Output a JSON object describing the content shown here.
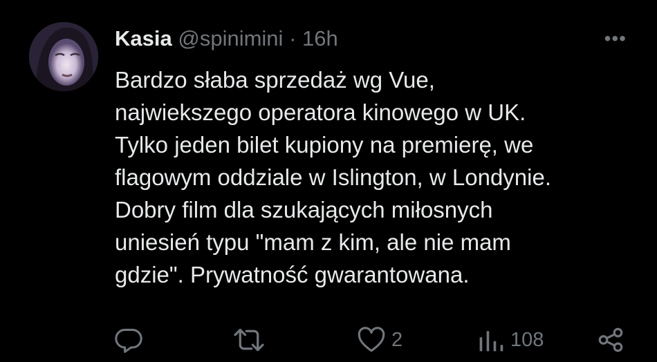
{
  "author": {
    "name": "Kasia",
    "handle": "@spinimini",
    "separator": "·",
    "time": "16h"
  },
  "tweet": {
    "lines": [
      "Bardzo słaba sprzedaż wg Vue,",
      "najwiekszego operatora kinowego w UK.",
      "Tylko jeden bilet kupiony na premierę, we",
      "flagowym oddziale w Islington, w Londynie.",
      "Dobry film dla szukających miłosnych",
      "uniesień typu \"mam z kim, ale nie mam",
      "gdzie\". Prywatność gwarantowana."
    ]
  },
  "actions": {
    "reply_icon": "reply-icon",
    "retweet_icon": "retweet-icon",
    "like_icon": "heart-icon",
    "like_count": "2",
    "views_icon": "views-icon",
    "views_count": "108",
    "share_icon": "share-icon"
  },
  "more_label": "•••",
  "colors": {
    "background": "#000000",
    "text": "#e7e9ea",
    "muted": "#71767b"
  }
}
